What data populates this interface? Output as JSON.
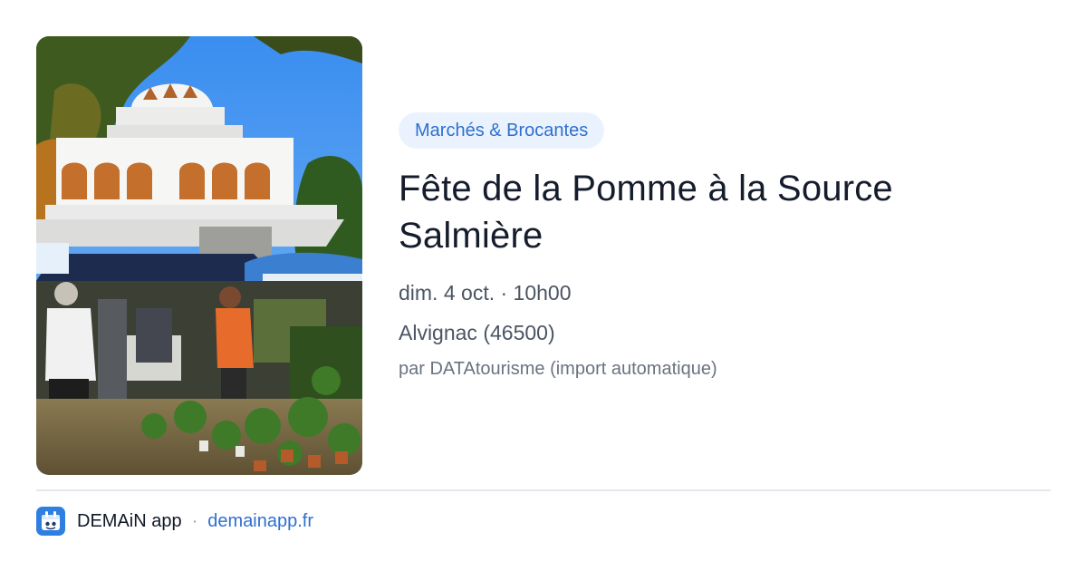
{
  "event": {
    "category": "Marchés & Brocantes",
    "title_line1": "Fête de la Pomme à la Source",
    "title_line2": "Salmière",
    "datetime": "dim. 4 oct. · 10h00",
    "location": "Alvignac (46500)",
    "author": "par DATAtourisme (import automatique)"
  },
  "footer": {
    "app_name": "DEMAiN app",
    "separator": "·",
    "site": "demainapp.fr"
  },
  "icons": {
    "app": "demain-app-icon"
  },
  "colors": {
    "accent": "#2f6fcf",
    "badge_bg": "#eaf3fd",
    "title": "#151c2c",
    "meta": "#4b5563",
    "divider": "#e3e8ee"
  }
}
